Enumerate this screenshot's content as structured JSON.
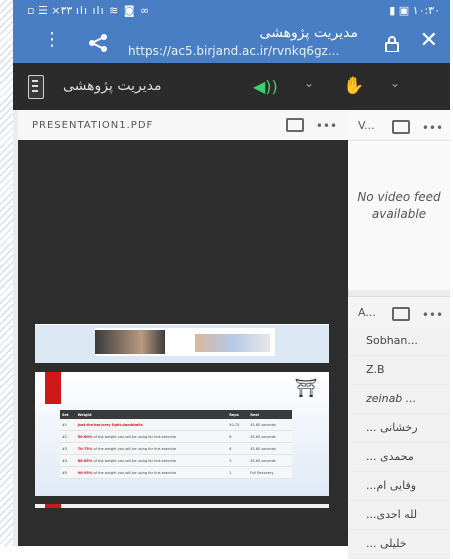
{
  "status": {
    "left": "▫ ☰ ×۳۳ ılı ılı ≋ ◙ ∞",
    "time": "۱۰:۳۰"
  },
  "browser": {
    "title": "مدیریت پژوهشی",
    "url": "https://ac5.birjand.ac.ir/rvnkq6gz..."
  },
  "toolbar": {
    "room_title": "مدیریت پژوهشی"
  },
  "presentation": {
    "title": "PRESENTATION1.PDF",
    "table": {
      "headers": [
        "Set",
        "Weight",
        "Reps",
        "Rest"
      ],
      "rows": [
        [
          "#1",
          "Just the bar/very light dumbbells",
          "",
          "50-75",
          "45-60 seconds"
        ],
        [
          "#2",
          "50-60%",
          " of the weight you will be using for this exercise",
          "8",
          "45-60 seconds"
        ],
        [
          "#3",
          "70-75%",
          " of the weight you will be using for this exercise",
          "6",
          "45-60 seconds"
        ],
        [
          "#4",
          "80-85%",
          " of the weight you will be using for this exercise",
          "3",
          "45-60 seconds"
        ],
        [
          "#5",
          "90-95%",
          " of the weight you will be using for this exercise",
          "1",
          "Full Recovery"
        ]
      ]
    }
  },
  "video": {
    "title": "V...",
    "no_feed": "No video feed available"
  },
  "attendees": {
    "title": "A...",
    "items": [
      "Sobhan...",
      "Z.B",
      "zeinab ...",
      "... رخشانی",
      "... محمدی",
      "...وفایی ام",
      "...لله احدی",
      "... خلیلی"
    ]
  },
  "colors": {
    "browser_bar": "#4a7ec4",
    "toolbar": "#2b2b2b",
    "speaker_active": "#3fcf6e",
    "slide_accent": "#d01818"
  }
}
